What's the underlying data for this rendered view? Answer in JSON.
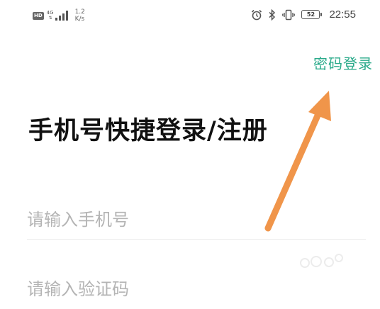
{
  "status_bar": {
    "hd_badge": "HD",
    "network_type": "4G",
    "network_arrows": "⇅",
    "speed_value": "1.2",
    "speed_unit": "K/s",
    "battery_level": "52",
    "time": "22:55"
  },
  "header": {
    "password_login_label": "密码登录"
  },
  "main": {
    "title": "手机号快捷登录/注册",
    "phone_input": {
      "placeholder": "请输入手机号",
      "value": ""
    },
    "code_input": {
      "placeholder": "请输入验证码",
      "value": ""
    }
  },
  "colors": {
    "accent": "#2aaa8a",
    "annotation_arrow": "#f0954a",
    "placeholder": "#b4b4b4"
  }
}
